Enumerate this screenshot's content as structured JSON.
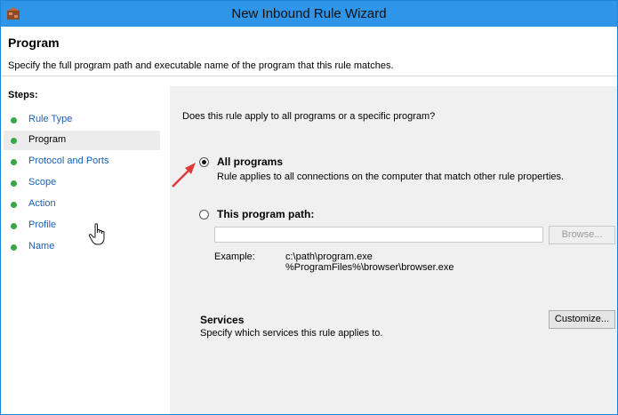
{
  "window": {
    "title": "New Inbound Rule Wizard",
    "app_icon": "firewall-icon"
  },
  "header": {
    "title": "Program",
    "description": "Specify the full program path and executable name of the program that this rule matches."
  },
  "steps": {
    "heading": "Steps:",
    "items": [
      {
        "label": "Rule Type",
        "active": false
      },
      {
        "label": "Program",
        "active": true
      },
      {
        "label": "Protocol and Ports",
        "active": false
      },
      {
        "label": "Scope",
        "active": false
      },
      {
        "label": "Action",
        "active": false
      },
      {
        "label": "Profile",
        "active": false
      },
      {
        "label": "Name",
        "active": false
      }
    ],
    "dot_color": "#3aa64a"
  },
  "main": {
    "question": "Does this rule apply to all programs or a specific program?",
    "options": {
      "all_programs": {
        "label": "All programs",
        "description": "Rule applies to all connections on the computer that match other rule properties.",
        "selected": true
      },
      "program_path": {
        "label": "This program path:",
        "value": "",
        "selected": false
      }
    },
    "browse_label": "Browse...",
    "example_label": "Example:",
    "example_lines": [
      "c:\\path\\program.exe",
      "%ProgramFiles%\\browser\\browser.exe"
    ],
    "services": {
      "title": "Services",
      "description": "Specify which services this rule applies to.",
      "customize_label": "Customize..."
    }
  },
  "colors": {
    "titlebar": "#2f95e8",
    "link": "#1c5fb4",
    "annotation_arrow": "#e03a3a"
  }
}
